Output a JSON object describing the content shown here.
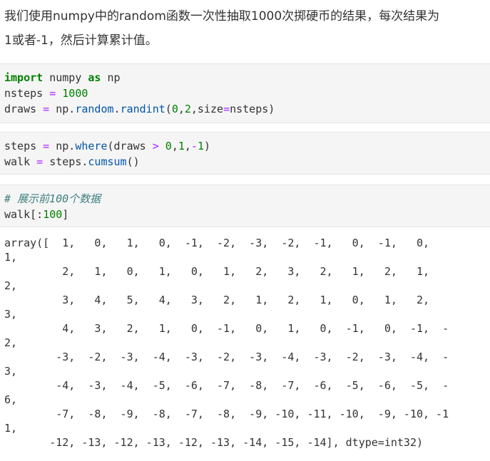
{
  "intro": {
    "line1": "我们使用numpy中的random函数一次性抽取1000次掷硬币的结果，每次结果为",
    "line2": "1或者-1，然后计算累计值。"
  },
  "cells": {
    "cell1": {
      "line1": {
        "kw1": "import",
        "name": " numpy ",
        "kw2": "as",
        "alias": " np"
      },
      "line2": {
        "var": "nsteps",
        "eq": " = ",
        "val": "1000"
      },
      "line3": {
        "var": "draws",
        "eq": " = ",
        "obj": "np.",
        "mod": "random",
        "dot": ".",
        "fn": "randint",
        "args_open": "(",
        "a1": "0",
        "c1": ",",
        "a2": "2",
        "c2": ",size",
        "eq2": "=",
        "a3": "nsteps)"
      }
    },
    "cell2": {
      "line1": {
        "var": "steps",
        "eq": " = ",
        "obj": "np.",
        "fn": "where",
        "args1": "(draws ",
        "gt": ">",
        "sp": " ",
        "a1": "0",
        "c1": ",",
        "a2": "1",
        "c2": ",",
        "neg": "-",
        "a3": "1",
        "close": ")"
      },
      "line2": {
        "var": "walk",
        "eq": " = ",
        "obj": "steps.",
        "fn": "cumsum",
        "args": "()"
      }
    },
    "cell3": {
      "comment": "# 展示前100个数据",
      "line2": {
        "var": "walk[:",
        "num": "100",
        "close": "]"
      }
    }
  },
  "output": {
    "lines": [
      "array([  1,   0,   1,   0,  -1,  -2,  -3,  -2,  -1,   0,  -1,   0,",
      "1,",
      "         2,   1,   0,   1,   0,   1,   2,   3,   2,   1,   2,   1,",
      "2,",
      "         3,   4,   5,   4,   3,   2,   1,   2,   1,   0,   1,   2,",
      "3,",
      "         4,   3,   2,   1,   0,  -1,   0,   1,   0,  -1,   0,  -1,  -",
      "2,",
      "        -3,  -2,  -3,  -4,  -3,  -2,  -3,  -4,  -3,  -2,  -3,  -4,  -",
      "3,",
      "        -4,  -3,  -4,  -5,  -6,  -7,  -8,  -7,  -6,  -5,  -6,  -5,  -",
      "6,",
      "        -7,  -8,  -9,  -8,  -7,  -8,  -9, -10, -11, -10,  -9, -10, -1",
      "1,",
      "       -12, -13, -12, -13, -12, -13, -14, -15, -14], dtype=int32)"
    ]
  }
}
